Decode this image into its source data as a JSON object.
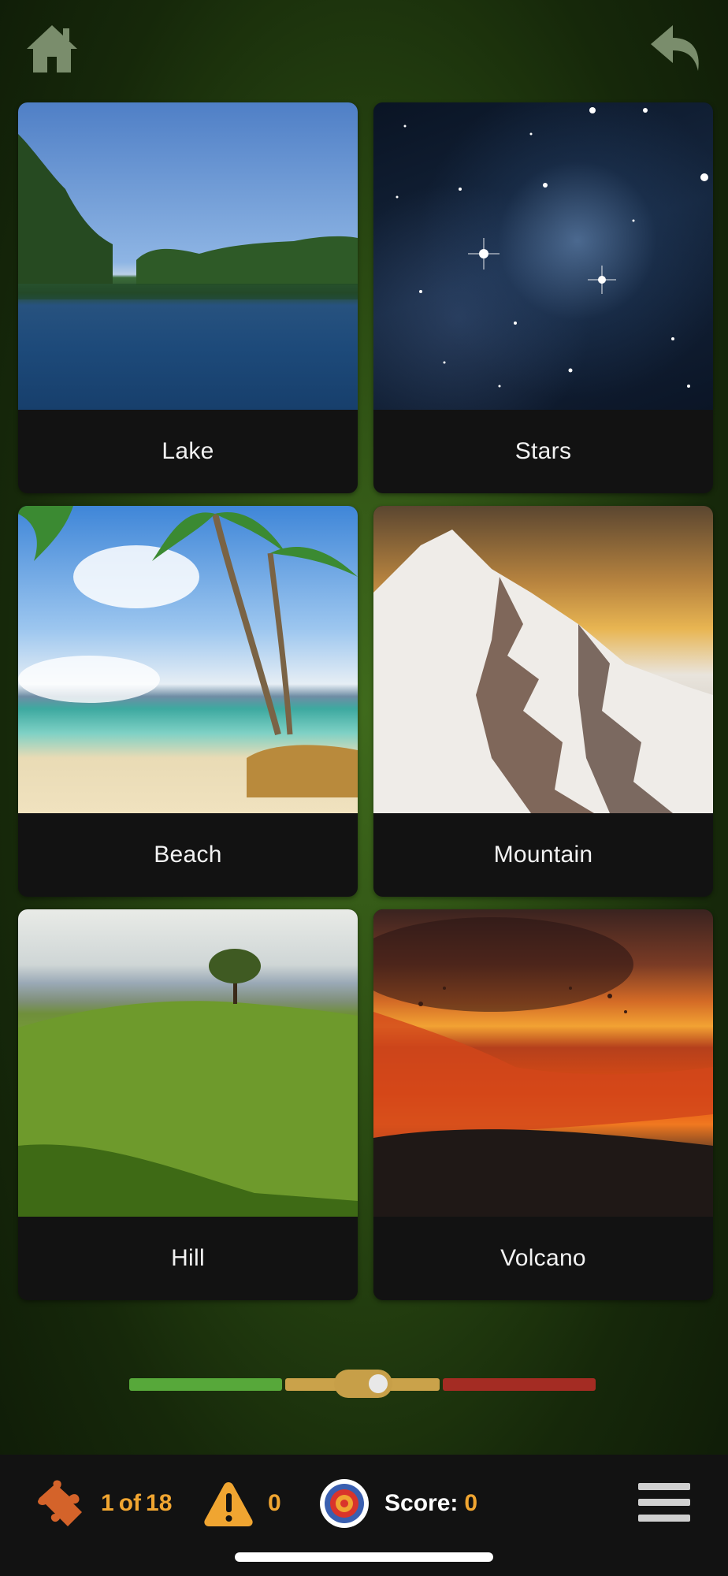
{
  "top_bar": {
    "home_icon": "home-icon",
    "back_icon": "undo-arrow-icon"
  },
  "cards": [
    {
      "label": "Lake",
      "image": "lake-photo"
    },
    {
      "label": "Stars",
      "image": "stars-photo"
    },
    {
      "label": "Beach",
      "image": "beach-photo"
    },
    {
      "label": "Mountain",
      "image": "mountain-photo"
    },
    {
      "label": "Hill",
      "image": "hill-photo"
    },
    {
      "label": "Volcano",
      "image": "volcano-photo"
    }
  ],
  "difficulty_slider": {
    "position": 0.5,
    "colors": [
      "#57a83a",
      "#caa24a",
      "#a42c23"
    ]
  },
  "bottom_bar": {
    "puzzle_icon": "puzzle-piece-icon",
    "progress_current": "1",
    "progress_of": "of",
    "progress_total": "18",
    "warning_icon": "warning-icon",
    "warnings": "0",
    "target_icon": "target-icon",
    "score_label": "Score:",
    "score_value": "0",
    "menu_icon": "hamburger-menu-icon"
  },
  "colors": {
    "accent": "#f0a531",
    "card_bg": "#121212",
    "bar_bg": "#121212"
  }
}
